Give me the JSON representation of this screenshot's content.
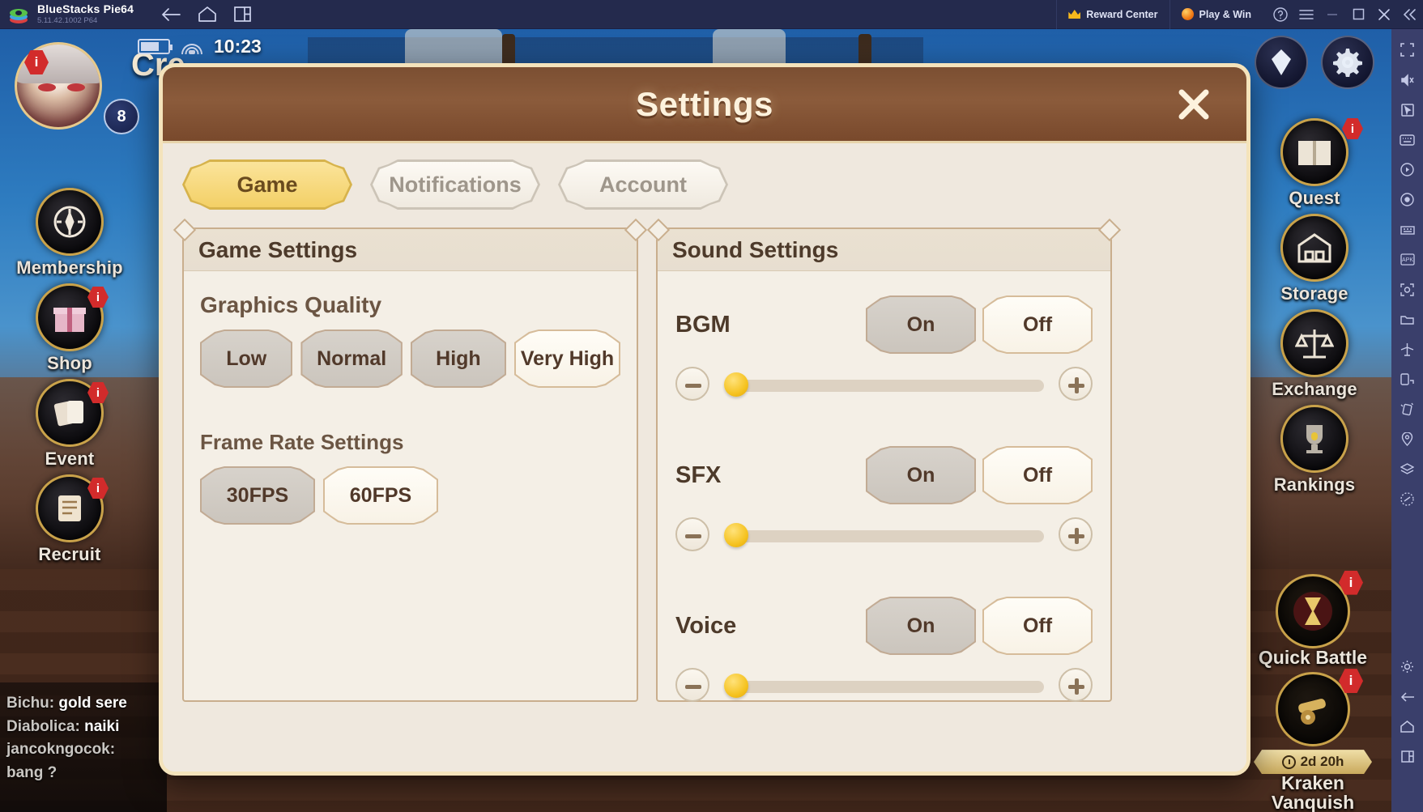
{
  "titlebar": {
    "app_name": "BlueStacks Pie64",
    "version": "5.11.42.1002 P64",
    "nav": [
      {
        "name": "back-icon",
        "label": "Back"
      },
      {
        "name": "home-icon",
        "label": "Home"
      },
      {
        "name": "recents-icon",
        "label": "Recents"
      }
    ],
    "reward_center": "Reward Center",
    "play_and_win": "Play & Win",
    "window_buttons": [
      {
        "name": "help-icon",
        "label": "Help"
      },
      {
        "name": "menu-icon",
        "label": "Menu"
      },
      {
        "name": "minimize-icon",
        "label": "Minimize"
      },
      {
        "name": "maximize-icon",
        "label": "Maximize"
      },
      {
        "name": "close-icon",
        "label": "Close"
      },
      {
        "name": "collapse-icon",
        "label": "Collapse"
      }
    ]
  },
  "game_hud": {
    "clock": "10:23",
    "player_level": "8",
    "screen_title": "Cre",
    "left_menu": [
      {
        "label": "Membership",
        "icon": "compass-icon",
        "badge": ""
      },
      {
        "label": "Shop",
        "icon": "giftbox-icon",
        "badge": "i"
      },
      {
        "label": "Event",
        "icon": "cards-icon",
        "badge": "i"
      },
      {
        "label": "Recruit",
        "icon": "scroll-icon",
        "badge": "i"
      }
    ],
    "right_menu": [
      {
        "label": "Quest",
        "icon": "book-icon",
        "badge": "i"
      },
      {
        "label": "Storage",
        "icon": "warehouse-icon",
        "badge": ""
      },
      {
        "label": "Exchange",
        "icon": "scales-icon",
        "badge": ""
      },
      {
        "label": "Rankings",
        "icon": "trophy-icon",
        "badge": ""
      }
    ],
    "top_right_buttons": [
      {
        "name": "crystal-icon"
      },
      {
        "name": "gear-icon"
      }
    ],
    "events": [
      {
        "label": "Quick Battle",
        "icon": "hourglass-icon",
        "badge": "i",
        "timer": ""
      },
      {
        "label": "Kraken Vanquish",
        "icon": "cannon-icon",
        "badge": "i",
        "timer": "2d 20h"
      }
    ],
    "chat_lines": [
      {
        "user": "Bichu:",
        "text": "gold sere"
      },
      {
        "user": "Diabolica:",
        "text": "naiki"
      },
      {
        "user": "jancokngocok:",
        "text": ""
      },
      {
        "user": "bang ?",
        "text": ""
      }
    ]
  },
  "bluestacks_sidebar": {
    "tools": [
      {
        "name": "fullscreen-icon"
      },
      {
        "name": "mute-icon"
      },
      {
        "name": "cursor-icon"
      },
      {
        "name": "keymapping-icon"
      },
      {
        "name": "macro-record-icon"
      },
      {
        "name": "screen-record-icon"
      },
      {
        "name": "multi-instance-icon"
      },
      {
        "name": "install-apk-icon"
      },
      {
        "name": "screenshot-icon"
      },
      {
        "name": "media-manager-icon"
      },
      {
        "name": "airplane-icon"
      },
      {
        "name": "rotate-icon"
      },
      {
        "name": "shake-icon"
      },
      {
        "name": "location-icon"
      },
      {
        "name": "eco-mode-icon"
      },
      {
        "name": "trim-memory-icon"
      },
      {
        "name": "settings-gear-icon"
      },
      {
        "name": "back-nav-icon"
      },
      {
        "name": "home-nav-icon"
      },
      {
        "name": "recents-nav-icon"
      }
    ]
  },
  "settings_dialog": {
    "title": "Settings",
    "close_label": "X",
    "tabs": [
      {
        "label": "Game",
        "active": true
      },
      {
        "label": "Notifications",
        "active": false
      },
      {
        "label": "Account",
        "active": false
      }
    ],
    "game_panel": {
      "heading": "Game Settings",
      "graphics": {
        "title": "Graphics Quality",
        "options": [
          {
            "label": "Low",
            "selected": false
          },
          {
            "label": "Normal",
            "selected": false
          },
          {
            "label": "High",
            "selected": false
          },
          {
            "label": "Very High",
            "selected": true
          }
        ]
      },
      "framerate": {
        "title": "Frame Rate Settings",
        "options": [
          {
            "label": "30FPS",
            "selected": false
          },
          {
            "label": "60FPS",
            "selected": true
          }
        ]
      }
    },
    "sound_panel": {
      "heading": "Sound Settings",
      "on_label": "On",
      "off_label": "Off",
      "channels": [
        {
          "label": "BGM",
          "state": "On",
          "volume": 0
        },
        {
          "label": "SFX",
          "state": "On",
          "volume": 0
        },
        {
          "label": "Voice",
          "state": "On",
          "volume": 0
        }
      ]
    }
  },
  "colors": {
    "titlebar_bg": "#242a4d",
    "sidebar_bg": "#3a3f6b",
    "modal_border": "#f4e3bb",
    "modal_header": "#8b5b3b",
    "tab_active": "#f3d066",
    "panel_bg": "#f4efe6",
    "knob": "#f5c21f",
    "badge_red": "#d22b2b"
  }
}
